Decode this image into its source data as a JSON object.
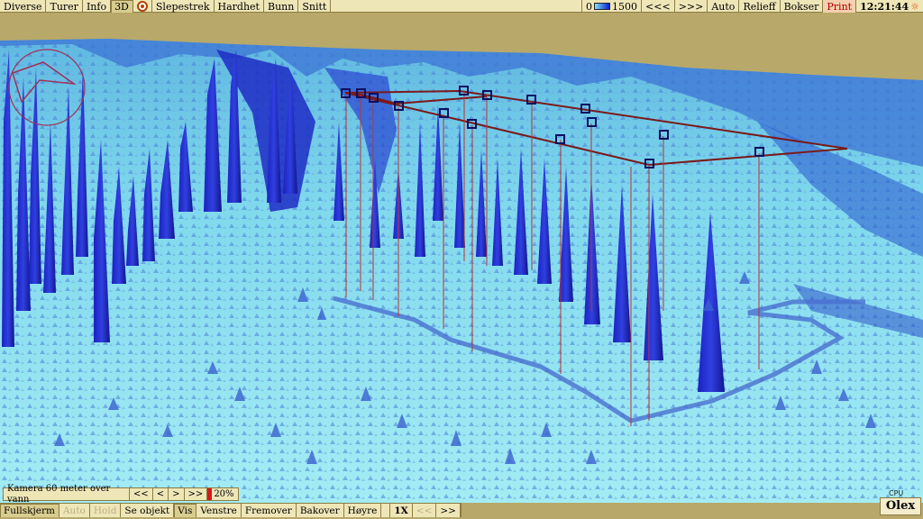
{
  "topbar": {
    "items": [
      "Diverse",
      "Turer",
      "Info",
      "3D"
    ],
    "items2": [
      "Slepestrek",
      "Hardhet",
      "Bunn",
      "Snitt"
    ],
    "depth_min": "0",
    "depth_max": "1500",
    "right_items": [
      "<<<",
      ">>>",
      "Auto",
      "Relieff",
      "Bokser"
    ],
    "print_label": "Print",
    "clock": "12:21:44"
  },
  "camera": {
    "text": "Kamera 60 meter over vann",
    "buttons": [
      "<<",
      "<",
      ">",
      ">>"
    ],
    "zoom": "20%"
  },
  "nav": {
    "fullscreen": "Fullskjerm",
    "auto": "Auto",
    "hold": "Hold",
    "see_object": "Se objekt",
    "view": "Vis",
    "left": "Venstre",
    "forward": "Fremover",
    "back": "Bakover",
    "right": "Høyre",
    "speed": "1X",
    "slower": "<<",
    "faster": ">>"
  },
  "status": {
    "cpu_temp": "CPU 30°C"
  },
  "logo": "Olex",
  "colors": {
    "sky": "#b8a869",
    "seabed_light": "#8fe0ee",
    "seabed_dark": "#1a1fb0",
    "toolbar_bg": "#efe6b8",
    "route": "#7a1a1a"
  },
  "icons": [
    "target-icon",
    "compass-icon",
    "sun-icon"
  ]
}
